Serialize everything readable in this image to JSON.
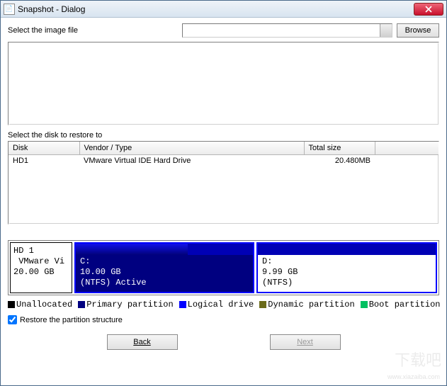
{
  "title": "Snapshot - Dialog",
  "file_select_label": "Select the image file",
  "image_file_value": "",
  "browse_label": "Browse",
  "disk_select_label": "Select the disk to restore to",
  "table": {
    "headers": {
      "disk": "Disk",
      "vendor": "Vendor / Type",
      "size": "Total size"
    },
    "rows": [
      {
        "disk": "HD1",
        "vendor": "VMware Virtual IDE Hard Drive",
        "size": "20.480MB"
      }
    ]
  },
  "disk_panel": {
    "name": "HD 1",
    "vendor_trunc": "VMware Vi",
    "size": "20.00 GB"
  },
  "partitions": [
    {
      "drive": "C:",
      "size": "10.00 GB",
      "fs": "(NTFS) Active",
      "selected": true
    },
    {
      "drive": "D:",
      "size": "9.99 GB",
      "fs": "(NTFS)",
      "selected": false
    }
  ],
  "legend": {
    "unallocated": "Unallocated",
    "primary": "Primary partition",
    "logical": "Logical drive",
    "dynamic": "Dynamic partition",
    "boot": "Boot partition"
  },
  "checkbox_label": "Restore the partition structure",
  "checkbox_checked": true,
  "buttons": {
    "back": "Back",
    "next": "Next"
  },
  "watermark": "下载吧",
  "watermark_url": "www.xiazaiba.com"
}
